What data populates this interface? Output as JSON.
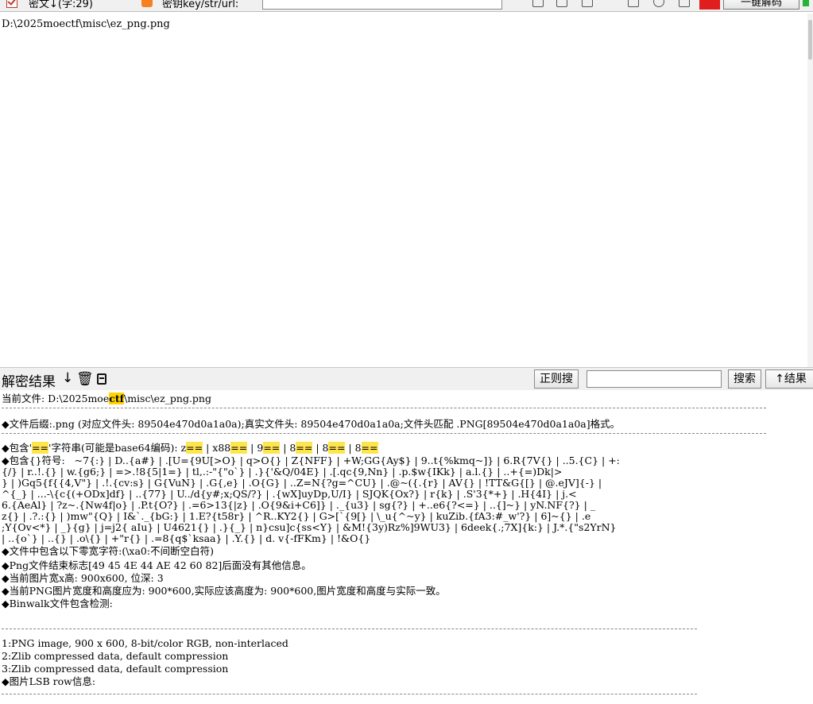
{
  "toolbar": {
    "cipher_label": "密文↓(字:29)",
    "key_label": "密钥key/str/url:",
    "key_value": "",
    "decode_button": "一键解码"
  },
  "input": {
    "text": "D:\\2025moectf\\misc\\ez_png.png"
  },
  "result_bar": {
    "title": "解密结果",
    "down_arrow": "↓",
    "trash_glyph": "🗑",
    "regex_button": "正则搜",
    "regex_value": "",
    "search_button": "搜索",
    "up_result_button": "↑结果"
  },
  "output": {
    "current_file_prefix": "当前文件: D:\\2025moe",
    "current_file_hl": "ctf",
    "current_file_suffix": "\\misc\\ez_png.png",
    "suffix_line": "◆文件后缀:.png (对应文件头: 89504e470d0a1a0a);真实文件头: 89504e470d0a1a0a;文件头匹配 .PNG[89504e470d0a1a0a]格式。",
    "b64_a": "◆包含'",
    "b64_b": "'字符串(可能是base64编码): z",
    "b64_c": " | x88",
    "b64_d": " | 9",
    "b64_e": " | 8",
    "b64_f": " | 8",
    "b64_g": " | 8",
    "eq": "==",
    "brace_lines": [
      "◆包含{}符号:   ~7{:} | D..{a#} | .[U={9U[>O} | q>O{} | Z{NFF} | +W;GG{Ay$} | 9..t{%kmq~]} | 6.R{7V{} | ..5.{C} | +:",
      "{/} | r..!.{} | w.{g6;} | =>.!8{5|1=} | tl,.:-\"{\"o`} | .}{'&Q/04E} | .[.qc{9,Nn} | .p.$w{IKk} | a.l.{} | ..+{=)Dk|>",
      "} | )Gq5{f{{4,V\"} | .!.{cv:s} | G{VuN} | .G{,e} | .O{G} | ..Z=N{?g=^CU} | .@~({.{r} | AV{} | !TT&G{[} | @.eJV]{-} |",
      "^{_} | ...-\\{c{(+ODx]df} | ..{77} | U../d{y#;x;QS/?} | .{wX]uyDp,U/I} | SJQK{Ox?} | r{k} | .S'3{*+} | .H{4I} | j.<",
      "6.{AeAl} | ?z~.{Nw4f|o} | .P.t{O?} | .=6>13{|z} | .O{9&i+C6]} | ._{u3} | sg{?} | +..e6{?<=} | ..{]~} | yN.NF{?} | _",
      "z{} | .?.:{} | )mw\"{Q} | I&`._{bG:} | 1.E?{t58r} | ^R..KY2{} | G>[`{9[} | \\_u{^~y} | kuZib.{fA3:#_w'?} | 6]~{} | .e",
      ";Y{Ov<*} | _}{g} | j=j2{ aIu} | U4621{} | .}{_} | n}csu]c{ss<Y} | &M!{3y)Rz%]9WU3} | 6deek{.;7X]{k:} | J.*.{\"s2YrN}",
      "| ..{o`} | ..{} | .o\\{} | +\"r{} | .=8{q$`ksaa} | .Y.{} | d. v{-fFKm} | !&O{}"
    ],
    "zero_width_line": "◆文件中包含以下零宽字符:(\\xa0:不间断空白符)",
    "iend_line": "◆Png文件结束标志[49 45 4E 44 AE 42 60 82]后面没有其他信息。",
    "wh_line": "◆当前图片宽x高: 900x600, 位深: 3",
    "wh2_line": "◆当前PNG图片宽度和高度应为: 900*600,实际应该高度为: 900*600,图片宽度和高度与实际一致。",
    "binwalk_header": "◆Binwalk文件包含检测:",
    "binwalk": [
      "1:PNG image, 900 x 600, 8-bit/color RGB, non-interlaced",
      "2:Zlib compressed data, default compression",
      "3:Zlib compressed data, default compression"
    ],
    "lsb_line": "◆图片LSB row信息:"
  },
  "colors": {
    "highlight": "#ffe54c",
    "toolbar_bg": "#f0f0f0",
    "red_button": "#e01e1e"
  }
}
